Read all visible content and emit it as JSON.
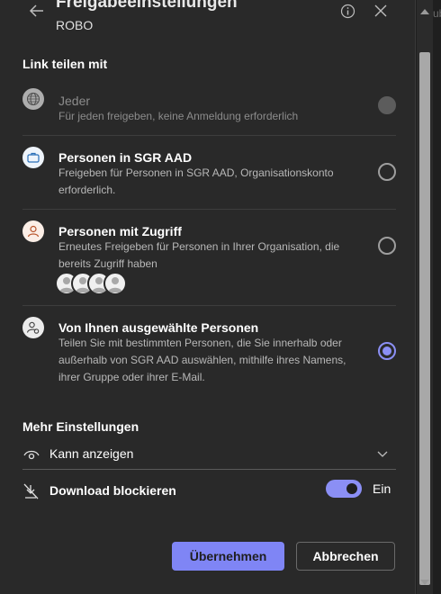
{
  "header": {
    "title": "Freigabeeinstellungen",
    "subtitle": "ROBO"
  },
  "link_section": {
    "title": "Link teilen mit",
    "options": [
      {
        "title": "Jeder",
        "description": "Für jeden freigeben, keine Anmeldung erforderlich",
        "state": "disabled",
        "icon": "globe-icon"
      },
      {
        "title": "Personen in SGR AAD",
        "description": "Freigeben für Personen in SGR AAD, Organisationskonto erforderlich.",
        "state": "unchecked",
        "icon": "briefcase-icon"
      },
      {
        "title": "Personen mit Zugriff",
        "description": "Erneutes Freigeben für Personen in Ihrer Organisation, die bereits Zugriff haben",
        "state": "unchecked",
        "icon": "person-icon"
      },
      {
        "title": "Von Ihnen ausgewählte Personen",
        "description": "Teilen Sie mit bestimmten Personen, die Sie innerhalb oder außerhalb von SGR AAD auswählen, mithilfe ihres Namens, ihrer Gruppe oder ihrer E-Mail.",
        "state": "checked",
        "icon": "people-settings-icon"
      }
    ]
  },
  "more_settings": {
    "title": "Mehr Einstellungen",
    "permission": "Kann anzeigen",
    "download_label": "Download blockieren",
    "toggle_state": "Ein"
  },
  "buttons": {
    "apply": "Übernehmen",
    "cancel": "Abbrechen"
  },
  "background_peek_text": "ub",
  "colors": {
    "accent": "#8b8ff5",
    "panel": "#292929",
    "primary_button": "#7f85f5"
  }
}
